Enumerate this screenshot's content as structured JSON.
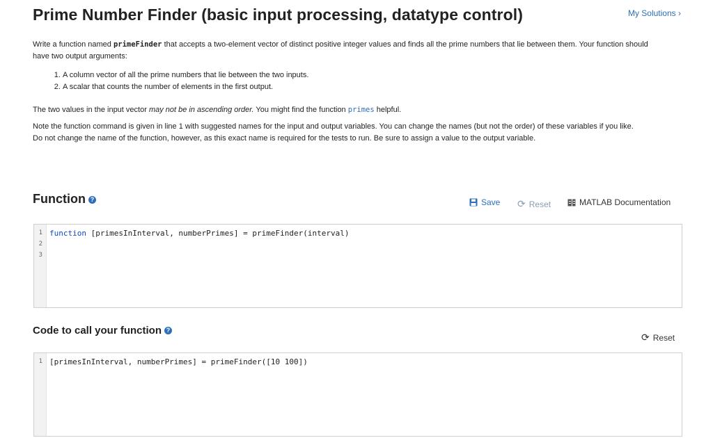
{
  "header": {
    "title": "Prime Number Finder (basic input processing, datatype control)",
    "my_solutions": "My Solutions",
    "my_solutions_icon": "chevron-right-icon"
  },
  "description": {
    "intro_1": "Write a function named ",
    "intro_func": "primeFinder",
    "intro_2": " that accepts a two-element vector of distinct positive integer values and finds all the prime numbers that lie between them. Your function should have two output arguments:",
    "list": [
      "A column vector of all the prime numbers that lie between the two inputs.",
      "A scalar that counts the number of elements in the first output."
    ],
    "order_1": "The two values in the input vector ",
    "order_em": "may not be in ascending order.",
    "order_2": " You might find the function ",
    "order_code": "primes",
    "order_3": " helpful.",
    "note_1": "Note the function command is given in line 1 with suggested names for the input and output variables.  You can change the names (but not the order) of these variables if you like.",
    "note_2": "Do not change the name of the function, however, as this exact name is required for the tests to run.  Be sure to assign a value to the output variable."
  },
  "function_section": {
    "title": "Function",
    "save": "Save",
    "reset": "Reset",
    "doc": "MATLAB Documentation",
    "line_numbers": [
      "1",
      "2",
      "3"
    ],
    "code_keyword": "function",
    "code_rest": " [primesInInterval, numberPrimes] = primeFinder(interval)"
  },
  "call_section": {
    "title": "Code to call your function",
    "reset": "Reset",
    "line_numbers": [
      "1"
    ],
    "code": "[primesInInterval, numberPrimes] = primeFinder([10 100])"
  },
  "colors": {
    "link": "#2d6fb8",
    "keyword": "#0e47d0",
    "disabled": "#8a9db3"
  }
}
